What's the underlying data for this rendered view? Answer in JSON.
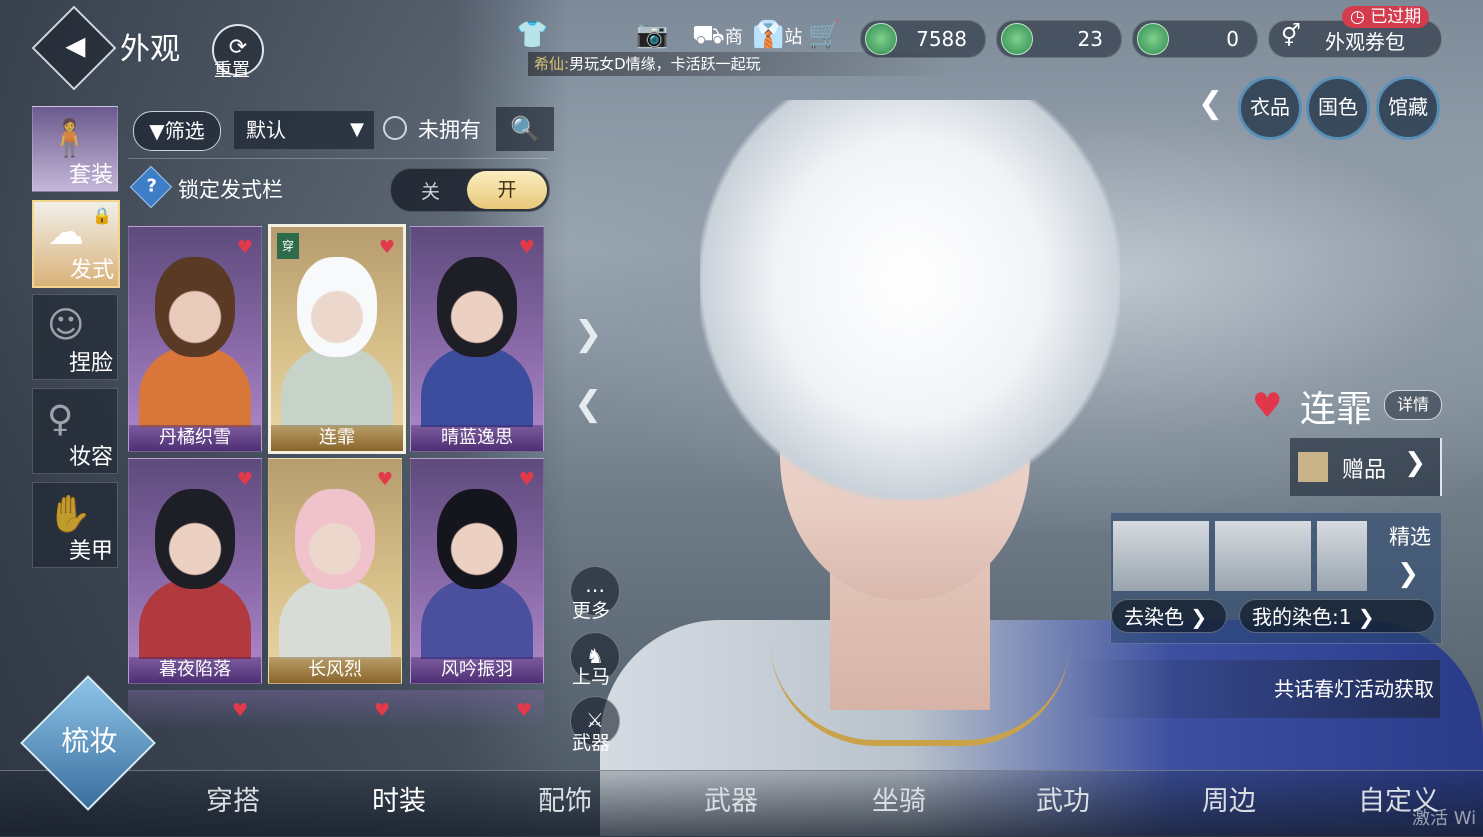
{
  "header": {
    "title": "外观",
    "reset_label": "重置",
    "shop_label": "商",
    "station_label": "站",
    "ticker_name": "希仙:",
    "ticker_text": "男玩女D情缘，卡活跃一起玩"
  },
  "currencies": [
    {
      "value": "7588"
    },
    {
      "value": "23"
    },
    {
      "value": "0"
    }
  ],
  "coupon": {
    "label": "外观券包",
    "badge": "已过期"
  },
  "right_tabs": [
    "衣品",
    "国色",
    "馆藏"
  ],
  "categories": [
    {
      "label": "套装"
    },
    {
      "label": "发式"
    },
    {
      "label": "捏脸"
    },
    {
      "label": "妆容"
    },
    {
      "label": "美甲"
    }
  ],
  "filter": {
    "filter_label": "筛选",
    "sort_value": "默认",
    "unowned_label": "未拥有",
    "lock_label": "锁定发式栏",
    "toggle_off": "关",
    "toggle_on": "开",
    "help": "?"
  },
  "cards": [
    {
      "name": "丹橘织雪",
      "theme": "purple"
    },
    {
      "name": "连霏",
      "theme": "gold",
      "selected": true,
      "tag": "穿"
    },
    {
      "name": "晴蓝逸思",
      "theme": "purple"
    },
    {
      "name": "暮夜陷落",
      "theme": "purple"
    },
    {
      "name": "长风烈",
      "theme": "gold"
    },
    {
      "name": "风吟振羽",
      "theme": "purple"
    }
  ],
  "actions": {
    "more": "更多",
    "mount": "上马",
    "weapon": "武器"
  },
  "item": {
    "name": "连霏",
    "detail": "详情",
    "gift": "赠品",
    "featured": "精选",
    "remove_dye": "去染色",
    "my_dye": "我的染色:1",
    "source": "共话春灯活动获取"
  },
  "makeup_button": "梳妆",
  "bottom_nav": [
    "穿搭",
    "时装",
    "配饰",
    "武器",
    "坐骑",
    "武功",
    "周边",
    "自定义"
  ],
  "watermark": "激活 Wi",
  "colors": {
    "accent_gold": "#e8c877",
    "heart": "#e23a4b",
    "badge_red": "#d23c4c"
  }
}
